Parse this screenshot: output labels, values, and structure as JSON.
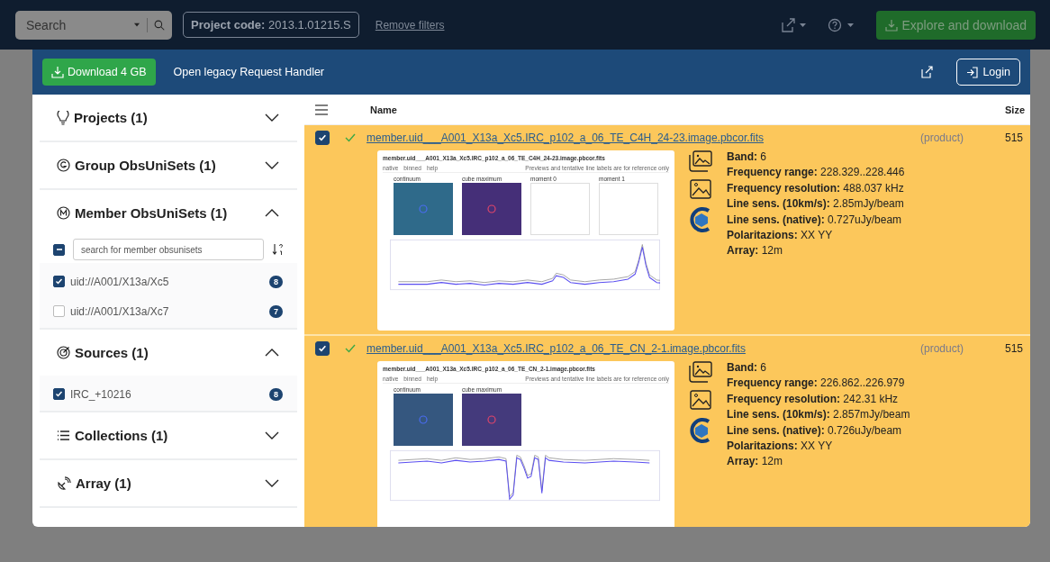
{
  "top_bar": {
    "search": {
      "placeholder": "Search"
    },
    "project_code": {
      "label": "Project code:",
      "value": "2013.1.01215.S"
    },
    "remove_filters": "Remove filters",
    "explore_button": "Explore and download"
  },
  "modal": {
    "download_button": "Download 4 GB",
    "legacy_link": "Open legacy Request Handler",
    "login_button": "Login"
  },
  "filters": [
    {
      "title": "Projects (1)",
      "expanded": false
    },
    {
      "title": "Group ObsUniSets (1)",
      "expanded": false
    },
    {
      "title": "Member ObsUniSets (1)",
      "expanded": true,
      "search": {
        "placeholder": "search for member obsunisets"
      },
      "select_all_indeterminate": true,
      "items": [
        {
          "label": "uid://A001/X13a/Xc5",
          "checked": true,
          "count": "8"
        },
        {
          "label": "uid://A001/X13a/Xc7",
          "checked": false,
          "count": "7"
        }
      ]
    },
    {
      "title": "Sources (1)",
      "expanded": true,
      "items": [
        {
          "label": "IRC_+10216",
          "checked": true,
          "count": "8"
        }
      ]
    },
    {
      "title": "Collections (1)",
      "expanded": false
    },
    {
      "title": "Array (1)",
      "expanded": false
    }
  ],
  "table": {
    "columns": [
      "Name",
      "Size"
    ],
    "rows": [
      {
        "checked": true,
        "verified": true,
        "name": "member.uid___A001_X13a_Xc5.IRC_p102_a_06_TE_C4H_24-23.image.pbcor.fits",
        "type": "(product)",
        "size": "515",
        "preview": {
          "title": "member.uid___A001_X13a_Xc5.IRC_p102_a_06_TE_C4H_24-23.image.pbcor.fits",
          "tabs": [
            "native",
            "binned",
            "help"
          ],
          "note": "Previews and tentative line labels are for reference only",
          "panels": [
            {
              "label": "continuum",
              "color": "#2f6a8a"
            },
            {
              "label": "cube maximum",
              "color": "#452f78"
            },
            {
              "label": "moment 0"
            },
            {
              "label": "moment 1"
            }
          ]
        },
        "details": [
          {
            "label": "Band:",
            "value": "6"
          },
          {
            "label": "Frequency range:",
            "value": "228.329..228.446"
          },
          {
            "label": "Frequency resolution:",
            "value": "488.037 kHz"
          },
          {
            "label": "Line sens. (10km/s):",
            "value": "2.85mJy/beam"
          },
          {
            "label": "Line sens. (native):",
            "value": "0.727uJy/beam"
          },
          {
            "label": "Polaritazions:",
            "value": "XX YY"
          },
          {
            "label": "Array:",
            "value": "12m"
          }
        ]
      },
      {
        "checked": true,
        "verified": true,
        "name": "member.uid___A001_X13a_Xc5.IRC_p102_a_06_TE_CN_2-1.image.pbcor.fits",
        "type": "(product)",
        "size": "515",
        "preview": {
          "title": "member.uid___A001_X13a_Xc5.IRC_p102_a_06_TE_CN_2-1.image.pbcor.fits",
          "tabs": [
            "native",
            "binned",
            "help"
          ],
          "note": "Previews and tentative line labels are for reference only",
          "panels": [
            {
              "label": "continuum",
              "color": "#35577f"
            },
            {
              "label": "cube maximum",
              "color": "#443a7c"
            }
          ]
        },
        "details": [
          {
            "label": "Band:",
            "value": "6"
          },
          {
            "label": "Frequency range:",
            "value": "226.862..226.979"
          },
          {
            "label": "Frequency resolution:",
            "value": "242.31 kHz"
          },
          {
            "label": "Line sens. (10km/s):",
            "value": "2.857mJy/beam"
          },
          {
            "label": "Line sens. (native):",
            "value": "0.726uJy/beam"
          },
          {
            "label": "Polaritazions:",
            "value": "XX YY"
          },
          {
            "label": "Array:",
            "value": "12m"
          }
        ]
      }
    ]
  }
}
